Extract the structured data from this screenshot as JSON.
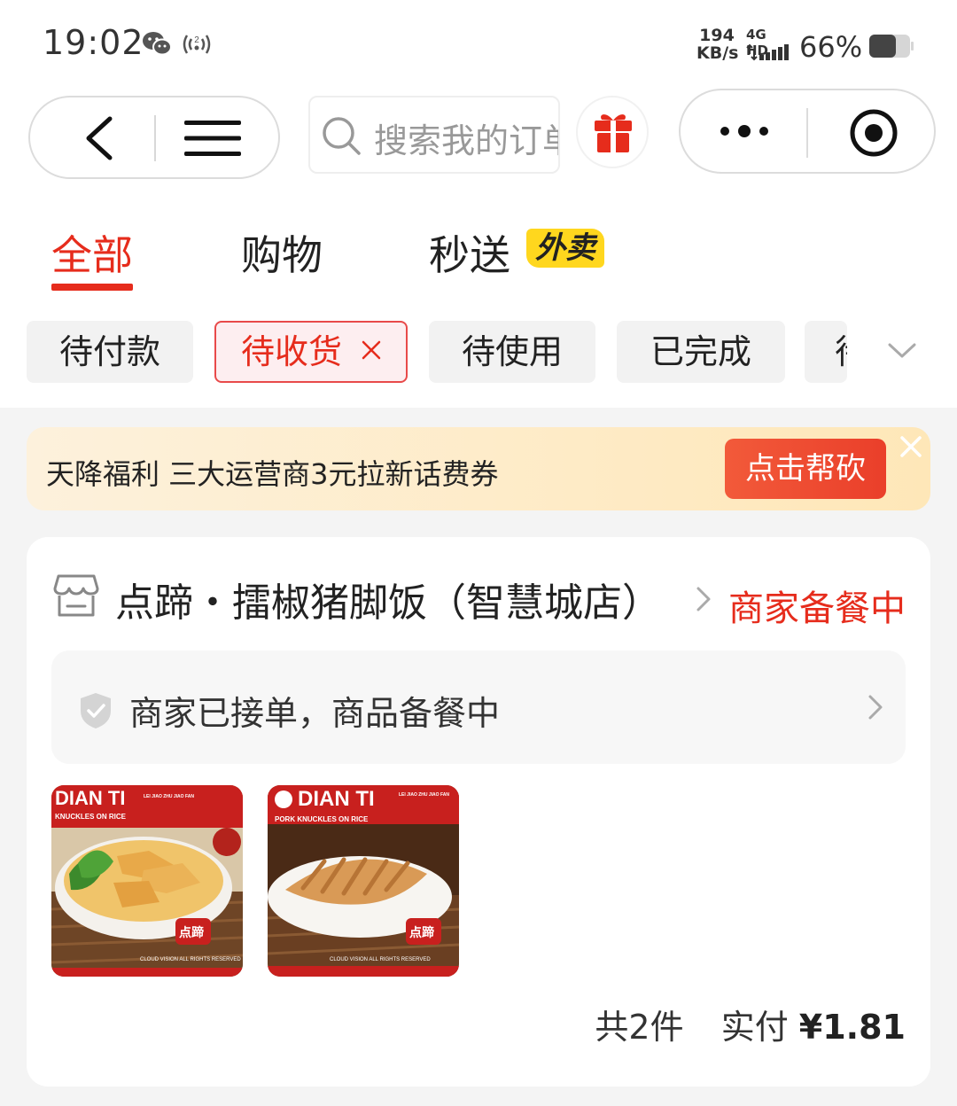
{
  "status_bar": {
    "time": "19:02",
    "net_speed_value": "194",
    "net_speed_unit": "KB/s",
    "network": "4G HD",
    "battery": "66%",
    "battery_level": 0.66
  },
  "nav": {
    "search_placeholder": "搜索我的订单"
  },
  "tabs": [
    {
      "label": "全部",
      "active": true
    },
    {
      "label": "购物",
      "active": false
    },
    {
      "label": "秒送",
      "badge": "外卖",
      "active": false
    }
  ],
  "filters": [
    {
      "label": "待付款",
      "selected": false
    },
    {
      "label": "待收货",
      "selected": true
    },
    {
      "label": "待使用",
      "selected": false
    },
    {
      "label": "已完成",
      "selected": false
    },
    {
      "label": "待",
      "selected": false
    }
  ],
  "banner": {
    "text": "天降福利 三大运营商3元拉新话费券",
    "button": "点击帮砍"
  },
  "order": {
    "store_name": "点蹄・擂椒猪脚饭（智慧城店）",
    "status": "商家备餐中",
    "progress": "商家已接单，商品备餐中",
    "items": [
      {
        "brand": "DIAN TI",
        "sub": "KNUCKLES ON RICE",
        "mini": "LEI JIAO ZHU JIAO FAN",
        "footer": "CLOUD VISION ALL RIGHTS RESERVED",
        "seal": "点蹄"
      },
      {
        "brand": "DIAN TI",
        "sub": "PORK KNUCKLES ON RICE",
        "mini": "LEI JIAO ZHU JIAO FAN",
        "footer": "CLOUD VISION ALL RIGHTS RESERVED",
        "seal": "点蹄"
      }
    ],
    "count": "共2件",
    "paid_label": "实付",
    "price": "¥1.81"
  },
  "colors": {
    "accent": "#e62c1c",
    "badge": "#ffd71e",
    "banner_button": "#ea3f2a"
  }
}
